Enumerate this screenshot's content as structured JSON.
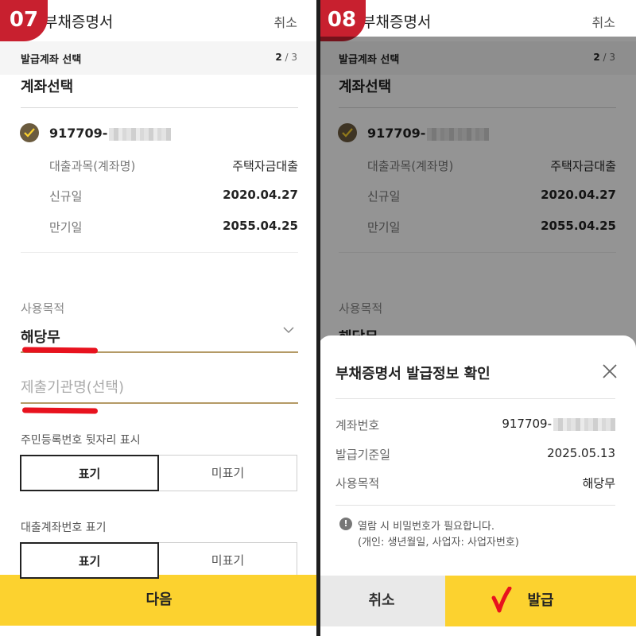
{
  "left": {
    "step_number": "07",
    "header": {
      "title": "부채증명서",
      "cancel": "취소"
    },
    "step": {
      "label": "발급계좌 선택",
      "current": "2",
      "total": "/ 3"
    },
    "section_title": "계좌선택",
    "account": {
      "number_prefix": "917709-",
      "rows": [
        {
          "label": "대출과목(계좌명)",
          "value": "주택자금대출"
        },
        {
          "label": "신규일",
          "value": "2020.04.27"
        },
        {
          "label": "만기일",
          "value": "2055.04.25"
        }
      ]
    },
    "purpose": {
      "label": "사용목적",
      "value": "해당무"
    },
    "institution": {
      "placeholder": "제출기관명(선택)"
    },
    "resident_toggle": {
      "label": "주민등록번호 뒷자리 표시",
      "on": "표기",
      "off": "미표기"
    },
    "loan_toggle": {
      "label": "대출계좌번호 표기",
      "on": "표기",
      "off": "미표기"
    },
    "next_button": "다음"
  },
  "right": {
    "step_number": "08",
    "header": {
      "title": "부채증명서",
      "cancel": "취소"
    },
    "step": {
      "label": "발급계좌 선택",
      "current": "2",
      "total": "/ 3"
    },
    "section_title": "계좌선택",
    "account": {
      "number_prefix": "917709-",
      "rows": [
        {
          "label": "대출과목(계좌명)",
          "value": "주택자금대출"
        },
        {
          "label": "신규일",
          "value": "2020.04.27"
        },
        {
          "label": "만기일",
          "value": "2055.04.25"
        }
      ]
    },
    "purpose": {
      "label": "사용목적",
      "value": "해당무"
    },
    "sheet": {
      "title": "부채증명서 발급정보 확인",
      "rows": [
        {
          "label": "계좌번호",
          "value": "917709-"
        },
        {
          "label": "발급기준일",
          "value": "2025.05.13"
        },
        {
          "label": "사용목적",
          "value": "해당무"
        }
      ],
      "notice_line1": "열람 시 비밀번호가 필요합니다.",
      "notice_line2": "(개인: 생년월일, 사업자: 사업자번호)",
      "cancel_button": "취소",
      "issue_button": "발급"
    }
  },
  "colors": {
    "badge": "#c8202f",
    "accent_yellow": "#fcd22f",
    "field_underline": "#b49a66",
    "check_circle": "#6b5b3e",
    "annotation_red": "#e8121e"
  }
}
